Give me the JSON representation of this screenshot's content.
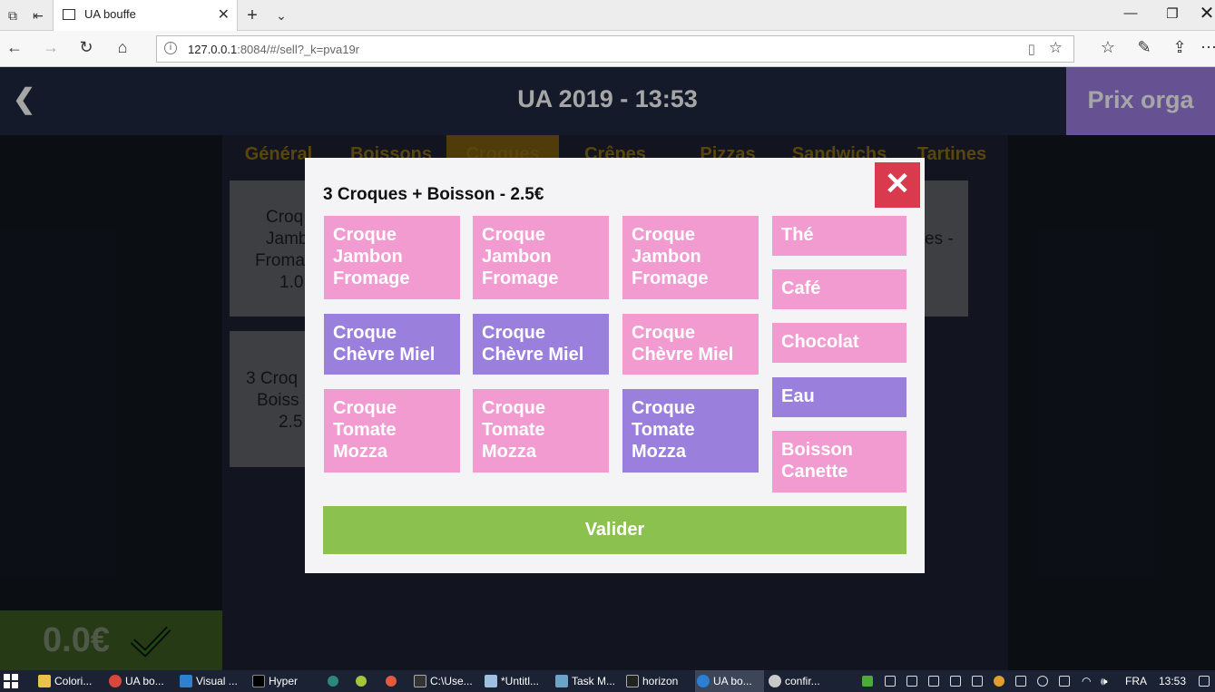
{
  "browser": {
    "tab_title": "UA bouffe",
    "url_host": "127.0.0.1",
    "url_rest": ":8084/#/sell?_k=pva19r"
  },
  "app": {
    "back_glyph": "❮",
    "title": "UA 2019 - 13:53",
    "prix_orga": "Prix orga",
    "total": "0.0€",
    "categories": [
      "Général",
      "Boissons",
      "Croques",
      "Crêpes",
      "Pizzas",
      "Sandwichs",
      "Tartines"
    ],
    "active_category": "Croques",
    "products_visible": [
      {
        "lines": [
          "Croq",
          "Jamb",
          "Froma",
          "1.0"
        ]
      },
      {
        "lines": [
          "3 Croq",
          "Boiss",
          "2.5"
        ]
      },
      {
        "lines": [
          "es -"
        ]
      }
    ]
  },
  "modal": {
    "title": "3 Croques + Boisson - 2.5€",
    "close_glyph": "✕",
    "columns": [
      [
        {
          "label": "Croque Jambon Fromage",
          "selected": false
        },
        {
          "label": "Croque Chèvre Miel",
          "selected": true
        },
        {
          "label": "Croque Tomate Mozza",
          "selected": false
        }
      ],
      [
        {
          "label": "Croque Jambon Fromage",
          "selected": false
        },
        {
          "label": "Croque Chèvre Miel",
          "selected": true
        },
        {
          "label": "Croque Tomate Mozza",
          "selected": false
        }
      ],
      [
        {
          "label": "Croque Jambon Fromage",
          "selected": false
        },
        {
          "label": "Croque Chèvre Miel",
          "selected": false
        },
        {
          "label": "Croque Tomate Mozza",
          "selected": true
        }
      ],
      [
        {
          "label": "Thé",
          "selected": false
        },
        {
          "label": "Café",
          "selected": false
        },
        {
          "label": "Chocolat",
          "selected": false
        },
        {
          "label": "Eau",
          "selected": true
        },
        {
          "label": "Boisson Canette",
          "selected": false
        }
      ]
    ],
    "validate_label": "Valider"
  },
  "colors": {
    "pink": "#f19bd1",
    "purple": "#9a80dc",
    "validate": "#8bc14f",
    "close": "#d93a4e",
    "header": "#212942"
  },
  "taskbar": {
    "items": [
      "Colori...",
      "UA bo...",
      "Visual ...",
      "Hyper",
      "C:\\Use...",
      "*Untitl...",
      "Task M...",
      "horizon",
      "UA bo...",
      "confir..."
    ],
    "lang": "FRA",
    "time": "13:53"
  }
}
